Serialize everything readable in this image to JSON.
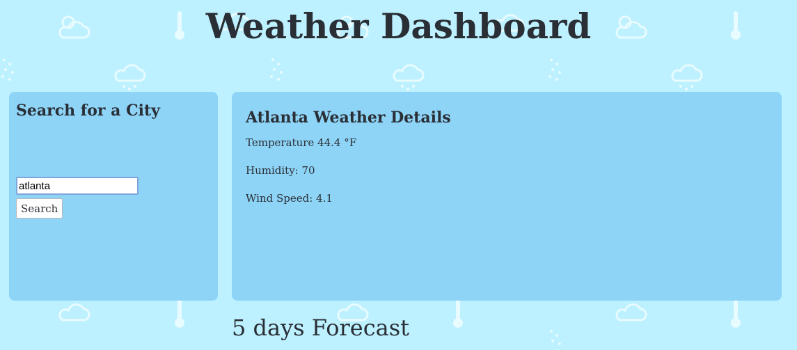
{
  "header": {
    "title": "Weather Dashboard"
  },
  "search_panel": {
    "title": "Search for a City",
    "input_value": "atlanta",
    "button_label": "Search"
  },
  "details_panel": {
    "title": "Atlanta Weather Details",
    "temperature": "Temperature 44.4 °F",
    "humidity": "Humidity: 70",
    "wind_speed": "Wind Speed: 4.1"
  },
  "forecast": {
    "heading": "5 days Forecast"
  },
  "colors": {
    "background": "#bdf1ff",
    "panel": "#8ed4f7",
    "text": "#2a2f36",
    "pattern": "#ffffff"
  },
  "icons": [
    "cloud-sun-icon",
    "thermometer-icon",
    "cloud-rain-icon",
    "snow-icon"
  ]
}
